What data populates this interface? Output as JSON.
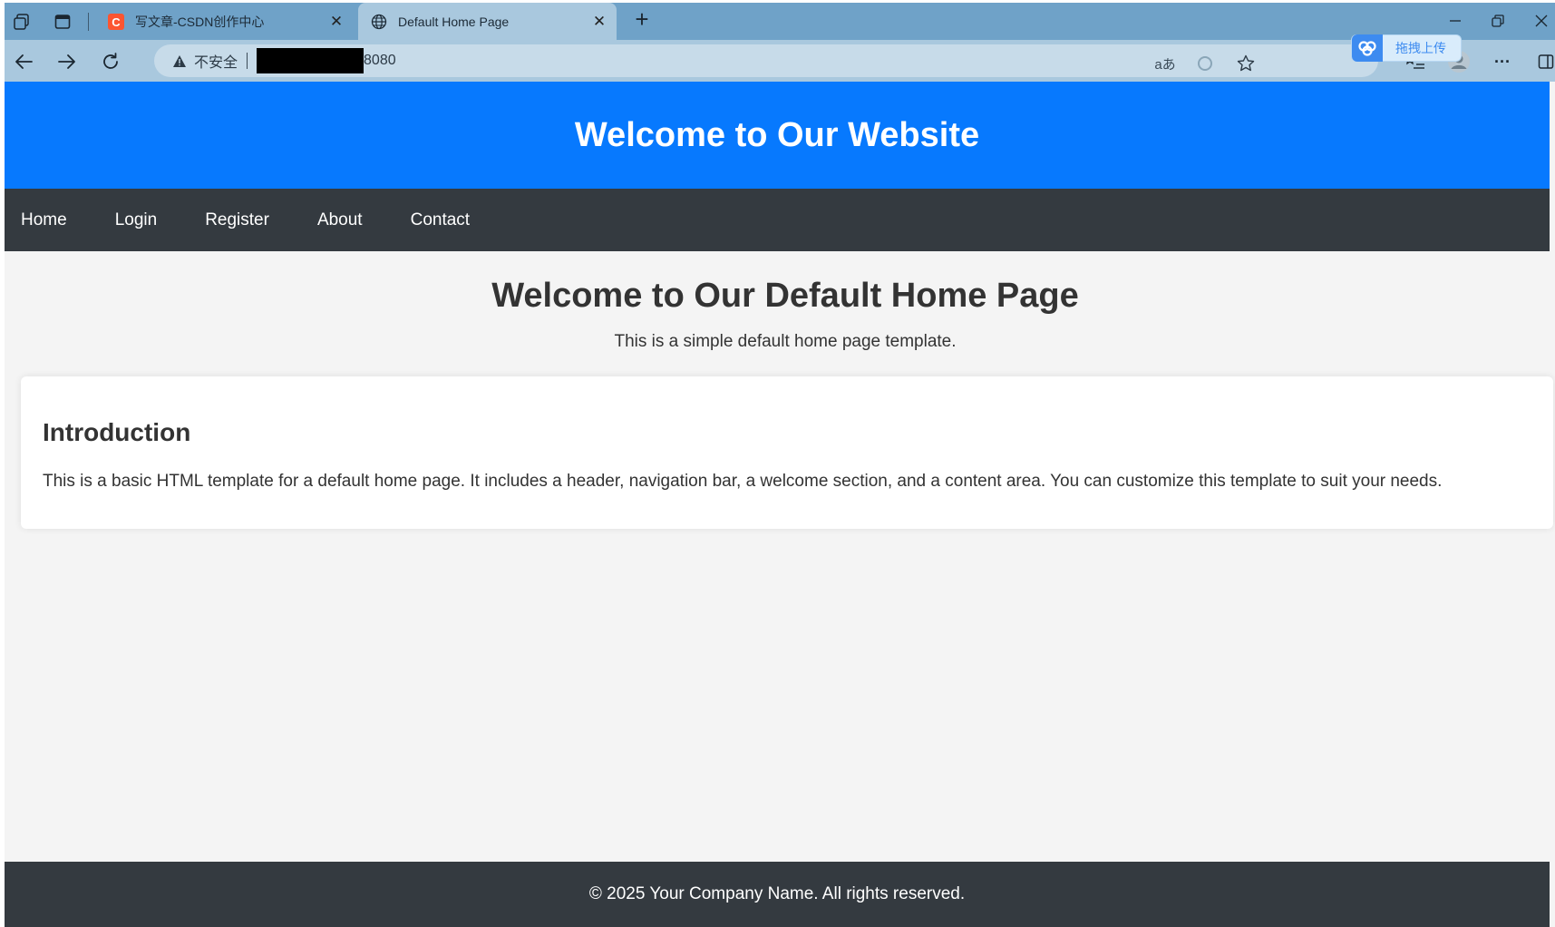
{
  "browser": {
    "tabs": [
      {
        "title": "写文章-CSDN创作中心",
        "favicon": "csdn-c-icon",
        "active": false
      },
      {
        "title": "Default Home Page",
        "favicon": "globe-icon",
        "active": true
      }
    ],
    "close_glyph": "✕",
    "new_tab_glyph": "+",
    "address": {
      "security_label": "不安全",
      "url_visible": "8080"
    },
    "upload_button": "拖拽上传",
    "translate_glyph": "aあ",
    "more_glyph": "···",
    "colors": {
      "tabstrip": "#6fa2c8",
      "toolbar": "#a9c8de",
      "address": "#c7dbe9"
    }
  },
  "site": {
    "header_title": "Welcome to Our Website",
    "nav": [
      "Home",
      "Login",
      "Register",
      "About",
      "Contact"
    ],
    "welcome_title": "Welcome to Our Default Home Page",
    "welcome_subtitle": "This is a simple default home page template.",
    "intro": {
      "title": "Introduction",
      "text": "This is a basic HTML template for a default home page. It includes a header, navigation bar, a welcome section, and a content area. You can customize this template to suit your needs."
    },
    "footer": "© 2025 Your Company Name. All rights reserved.",
    "colors": {
      "header": "#0779fe",
      "nav": "#343a40",
      "footer": "#343a40",
      "background": "#f4f4f4"
    }
  }
}
